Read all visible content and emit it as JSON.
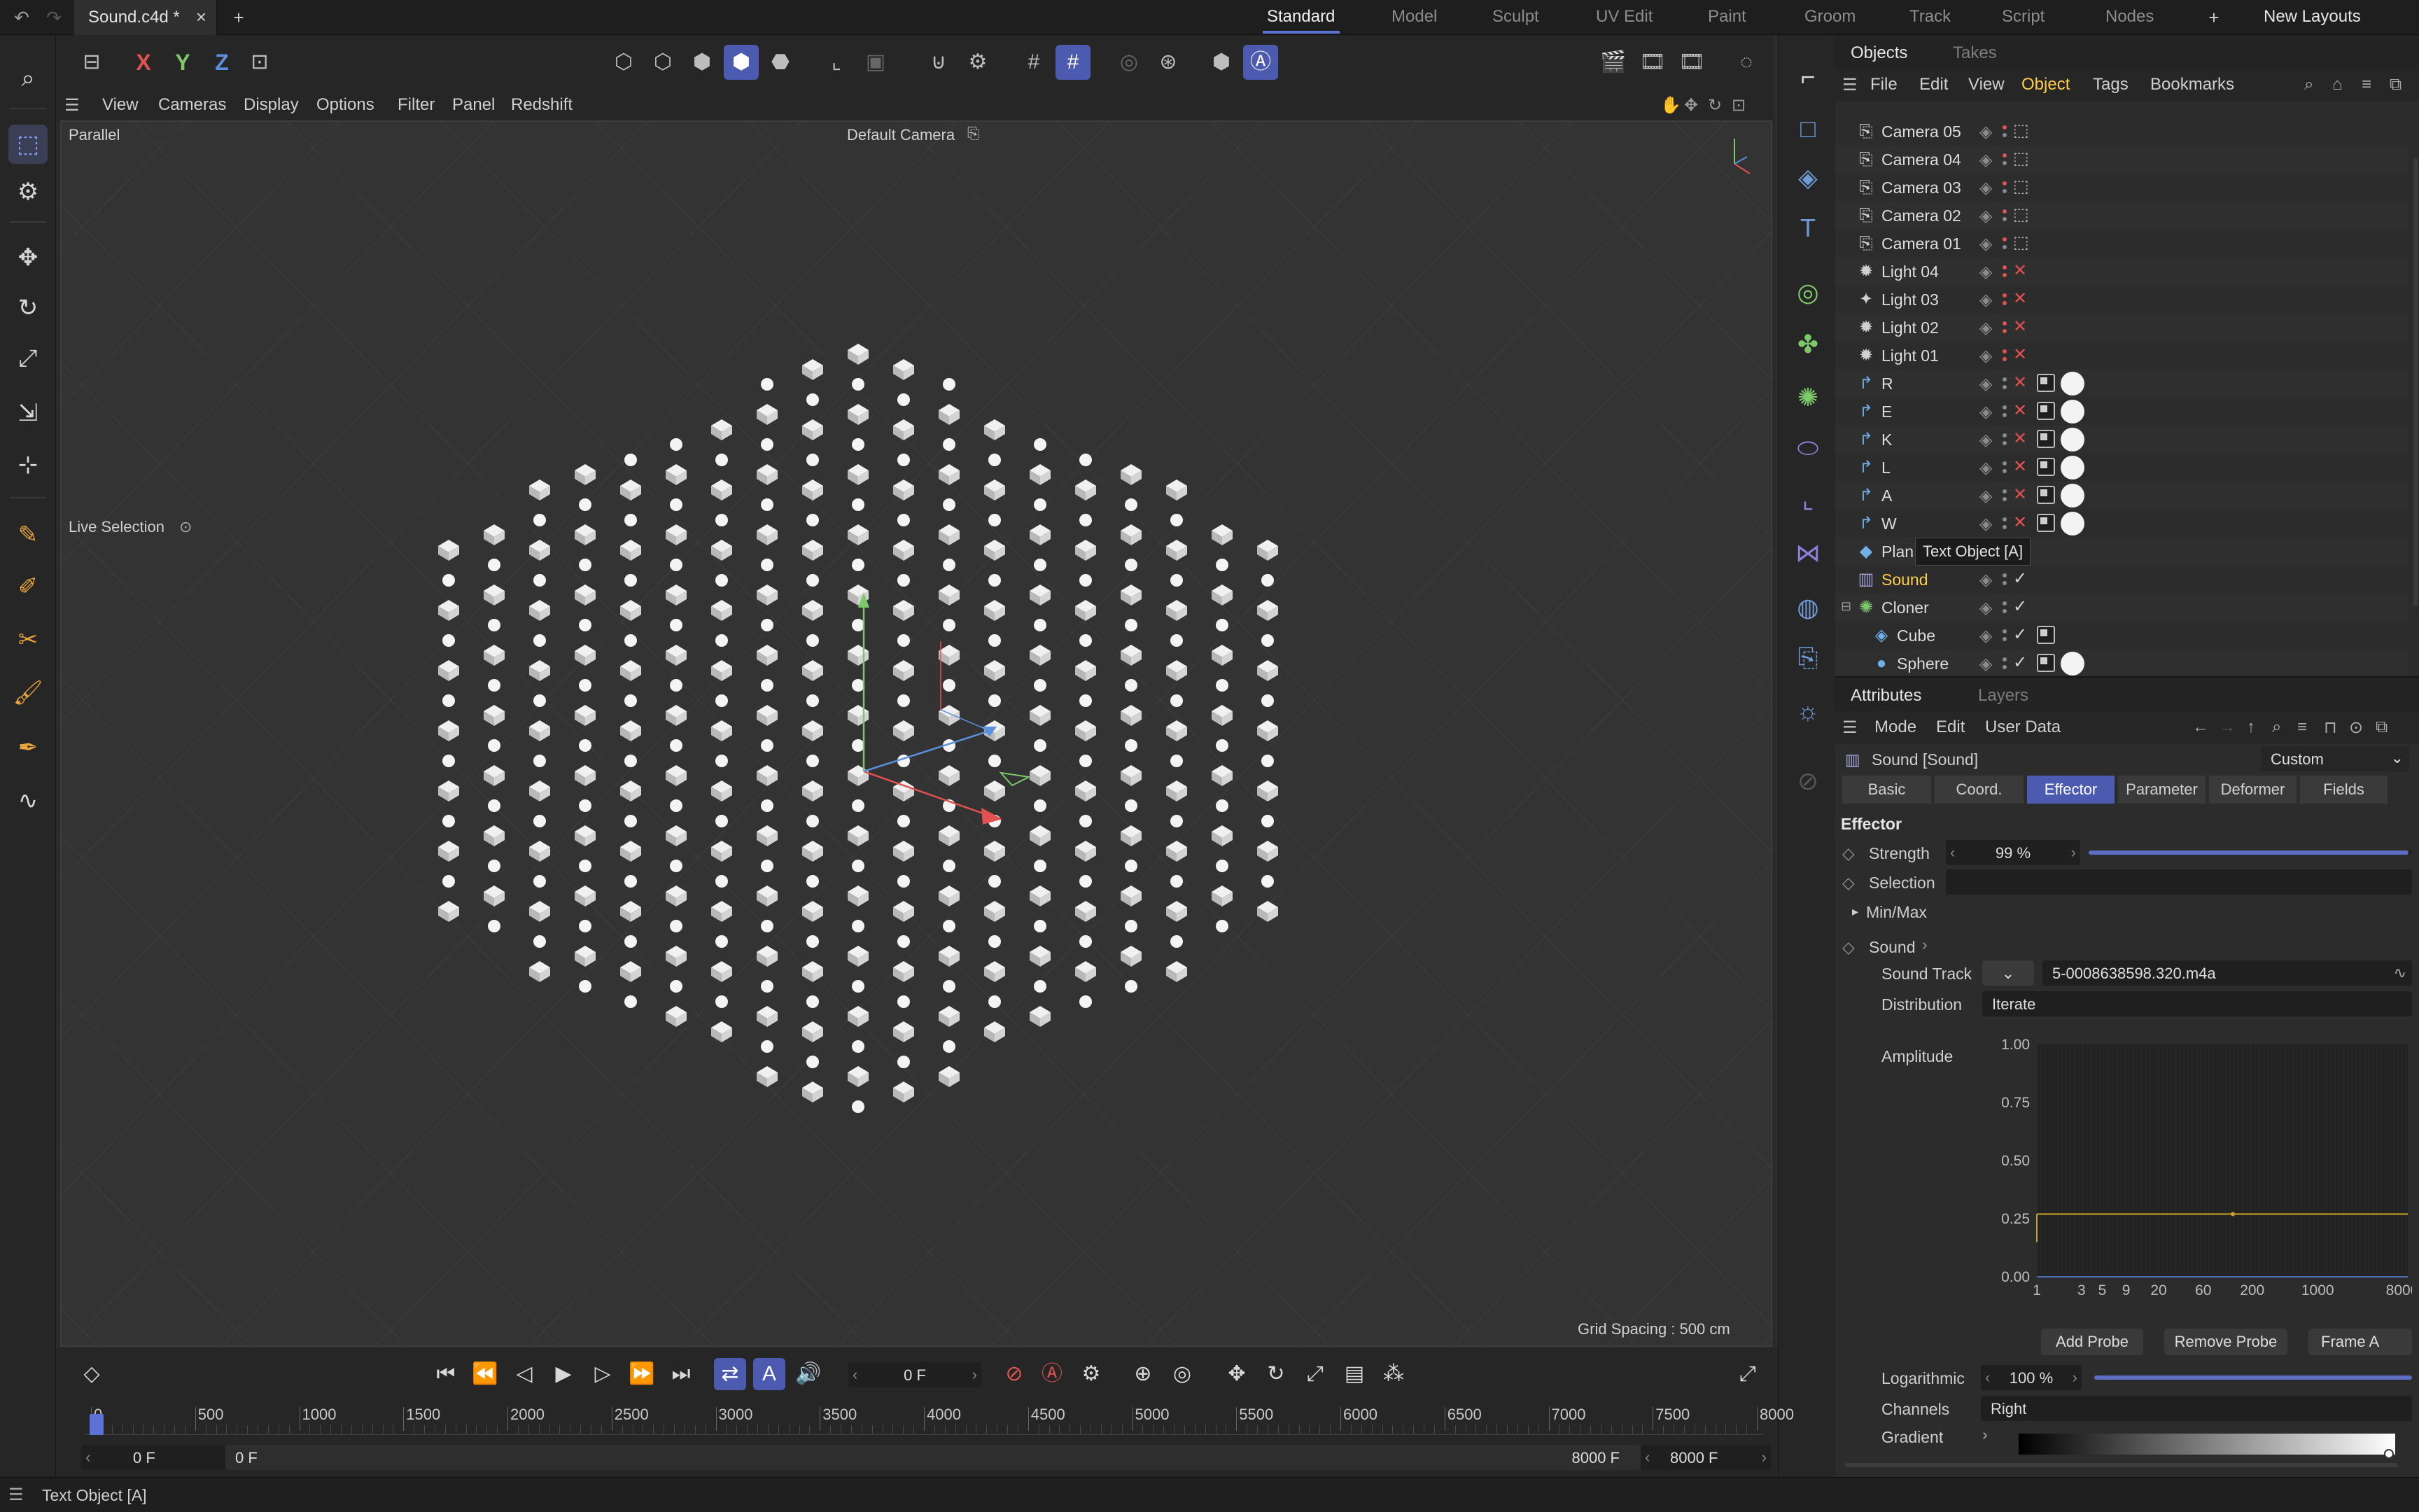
{
  "topbar": {
    "doc_title": "Sound.c4d *",
    "close_glyph": "×",
    "add_glyph": "+",
    "workspaces": [
      "Standard",
      "Model",
      "Sculpt",
      "UV Edit",
      "Paint",
      "Groom",
      "Track",
      "Script",
      "Nodes"
    ],
    "active_workspace": "Standard",
    "new_layouts": "New Layouts"
  },
  "toolbar": {
    "x_label": "X",
    "y_label": "Y",
    "z_label": "Z"
  },
  "viewport_menu": [
    "View",
    "Cameras",
    "Display",
    "Options",
    "Filter",
    "Panel",
    "Redshift"
  ],
  "viewport": {
    "projection": "Parallel",
    "camera": "Default Camera",
    "tool": "Live Selection",
    "grid_spacing": "Grid Spacing : 500 cm"
  },
  "objects_panel": {
    "tabs": [
      "Objects",
      "Takes"
    ],
    "menu": [
      "File",
      "Edit",
      "View",
      "Object",
      "Tags",
      "Bookmarks"
    ],
    "active_menu": "Object",
    "tooltip": "Text Object [A]",
    "items": [
      {
        "name": "Camera 05",
        "icon": "camera-icon",
        "glyph": "⎘",
        "flag": "⬚",
        "flag_color": "#bdbdbd",
        "tags": 0
      },
      {
        "name": "Camera 04",
        "icon": "camera-icon",
        "glyph": "⎘",
        "flag": "⬚",
        "flag_color": "#bdbdbd",
        "tags": 0
      },
      {
        "name": "Camera 03",
        "icon": "camera-icon",
        "glyph": "⎘",
        "flag": "⬚",
        "flag_color": "#bdbdbd",
        "tags": 0
      },
      {
        "name": "Camera 02",
        "icon": "camera-icon",
        "glyph": "⎘",
        "flag": "⬚",
        "flag_color": "#bdbdbd",
        "tags": 0
      },
      {
        "name": "Camera 01",
        "icon": "camera-icon",
        "glyph": "⎘",
        "flag": "⬚",
        "flag_color": "#bdbdbd",
        "tags": 0
      },
      {
        "name": "Light 04",
        "icon": "light-icon",
        "glyph": "✹",
        "flag": "✕",
        "flag_color": "#e0524f",
        "tags": 0
      },
      {
        "name": "Light 03",
        "icon": "light-icon",
        "glyph": "✦",
        "flag": "✕",
        "flag_color": "#e0524f",
        "tags": 0
      },
      {
        "name": "Light 02",
        "icon": "light-icon",
        "glyph": "✹",
        "flag": "✕",
        "flag_color": "#e0524f",
        "tags": 0
      },
      {
        "name": "Light 01",
        "icon": "light-icon",
        "glyph": "✹",
        "flag": "✕",
        "flag_color": "#e0524f",
        "tags": 0
      },
      {
        "name": "R",
        "icon": "text-spline-icon",
        "glyph": "↱",
        "flag": "✕",
        "flag_color": "#e0524f",
        "tags": 2
      },
      {
        "name": "E",
        "icon": "text-spline-icon",
        "glyph": "↱",
        "flag": "✕",
        "flag_color": "#e0524f",
        "tags": 2
      },
      {
        "name": "K",
        "icon": "text-spline-icon",
        "glyph": "↱",
        "flag": "✕",
        "flag_color": "#e0524f",
        "tags": 2
      },
      {
        "name": "L",
        "icon": "text-spline-icon",
        "glyph": "↱",
        "flag": "✕",
        "flag_color": "#e0524f",
        "tags": 2
      },
      {
        "name": "A",
        "icon": "text-spline-icon",
        "glyph": "↱",
        "flag": "✕",
        "flag_color": "#e0524f",
        "tags": 2
      },
      {
        "name": "W",
        "icon": "text-spline-icon",
        "glyph": "↱",
        "flag": "✕",
        "flag_color": "#e0524f",
        "tags": 2
      },
      {
        "name": "Plan",
        "icon": "plane-icon",
        "glyph": "◆",
        "flag": "",
        "flag_color": "#bdbdbd",
        "tags": 0
      },
      {
        "name": "Sound",
        "icon": "sound-effector-icon",
        "glyph": "▥",
        "flag": "✓",
        "flag_color": "#d6d6d6",
        "tags": 0,
        "selected": true
      },
      {
        "name": "Cloner",
        "icon": "cloner-icon",
        "glyph": "✺",
        "flag": "✓",
        "flag_color": "#d6d6d6",
        "tags": 0
      },
      {
        "name": "Cube",
        "icon": "cube-icon",
        "glyph": "◈",
        "flag": "✓",
        "flag_color": "#d6d6d6",
        "tags": 1,
        "child": true
      },
      {
        "name": "Sphere",
        "icon": "sphere-icon",
        "glyph": "●",
        "flag": "✓",
        "flag_color": "#d6d6d6",
        "tags": 2,
        "child": true
      }
    ]
  },
  "attributes": {
    "tabs": [
      "Attributes",
      "Layers"
    ],
    "menu": [
      "Mode",
      "Edit",
      "User Data"
    ],
    "object_title": "Sound [Sound]",
    "preset": "Custom",
    "subtabs": [
      "Basic",
      "Coord.",
      "Effector",
      "Parameter",
      "Deformer",
      "Fields"
    ],
    "active_subtab": "Effector",
    "section": "Effector",
    "strength_label": "Strength",
    "strength_value": "99 %",
    "strength_fraction": 0.99,
    "selection_label": "Selection",
    "minmax_label": "Min/Max",
    "sound_label": "Sound",
    "sound_track_label": "Sound Track",
    "sound_track_value": "5-0008638598.320.m4a",
    "distribution_label": "Distribution",
    "distribution_value": "Iterate",
    "amplitude_label": "Amplitude",
    "amp_y_ticks": [
      "1.00",
      "0.75",
      "0.50",
      "0.25",
      "0.00"
    ],
    "amp_x_ticks": [
      "1",
      "3",
      "5",
      "9",
      "20",
      "60",
      "200",
      "1000",
      "8000"
    ],
    "amp_level": 0.27,
    "add_probe": "Add Probe",
    "remove_probe": "Remove Probe",
    "frame_all": "Frame A",
    "logarithmic_label": "Logarithmic",
    "logarithmic_value": "100 %",
    "logarithmic_fraction": 1.0,
    "channels_label": "Channels",
    "channels_value": "Right",
    "gradient_label": "Gradient"
  },
  "timeline": {
    "current_frame": "0 F",
    "ruler": [
      "0",
      "500",
      "1000",
      "1500",
      "2000",
      "2500",
      "3000",
      "3500",
      "4000",
      "4500",
      "5000",
      "5500",
      "6000",
      "6500",
      "7000",
      "7500",
      "8000"
    ],
    "start_frame": "0 F",
    "range_start": "0 F",
    "range_end": "8000 F",
    "end_frame": "8000 F"
  },
  "status": {
    "text": "Text Object [A]"
  },
  "colors": {
    "accent": "#4c5ab0",
    "selected_text": "#ffcd4a",
    "x_axis": "#e0524f",
    "y_axis": "#7cc96a",
    "z_axis": "#5c8fdc"
  }
}
